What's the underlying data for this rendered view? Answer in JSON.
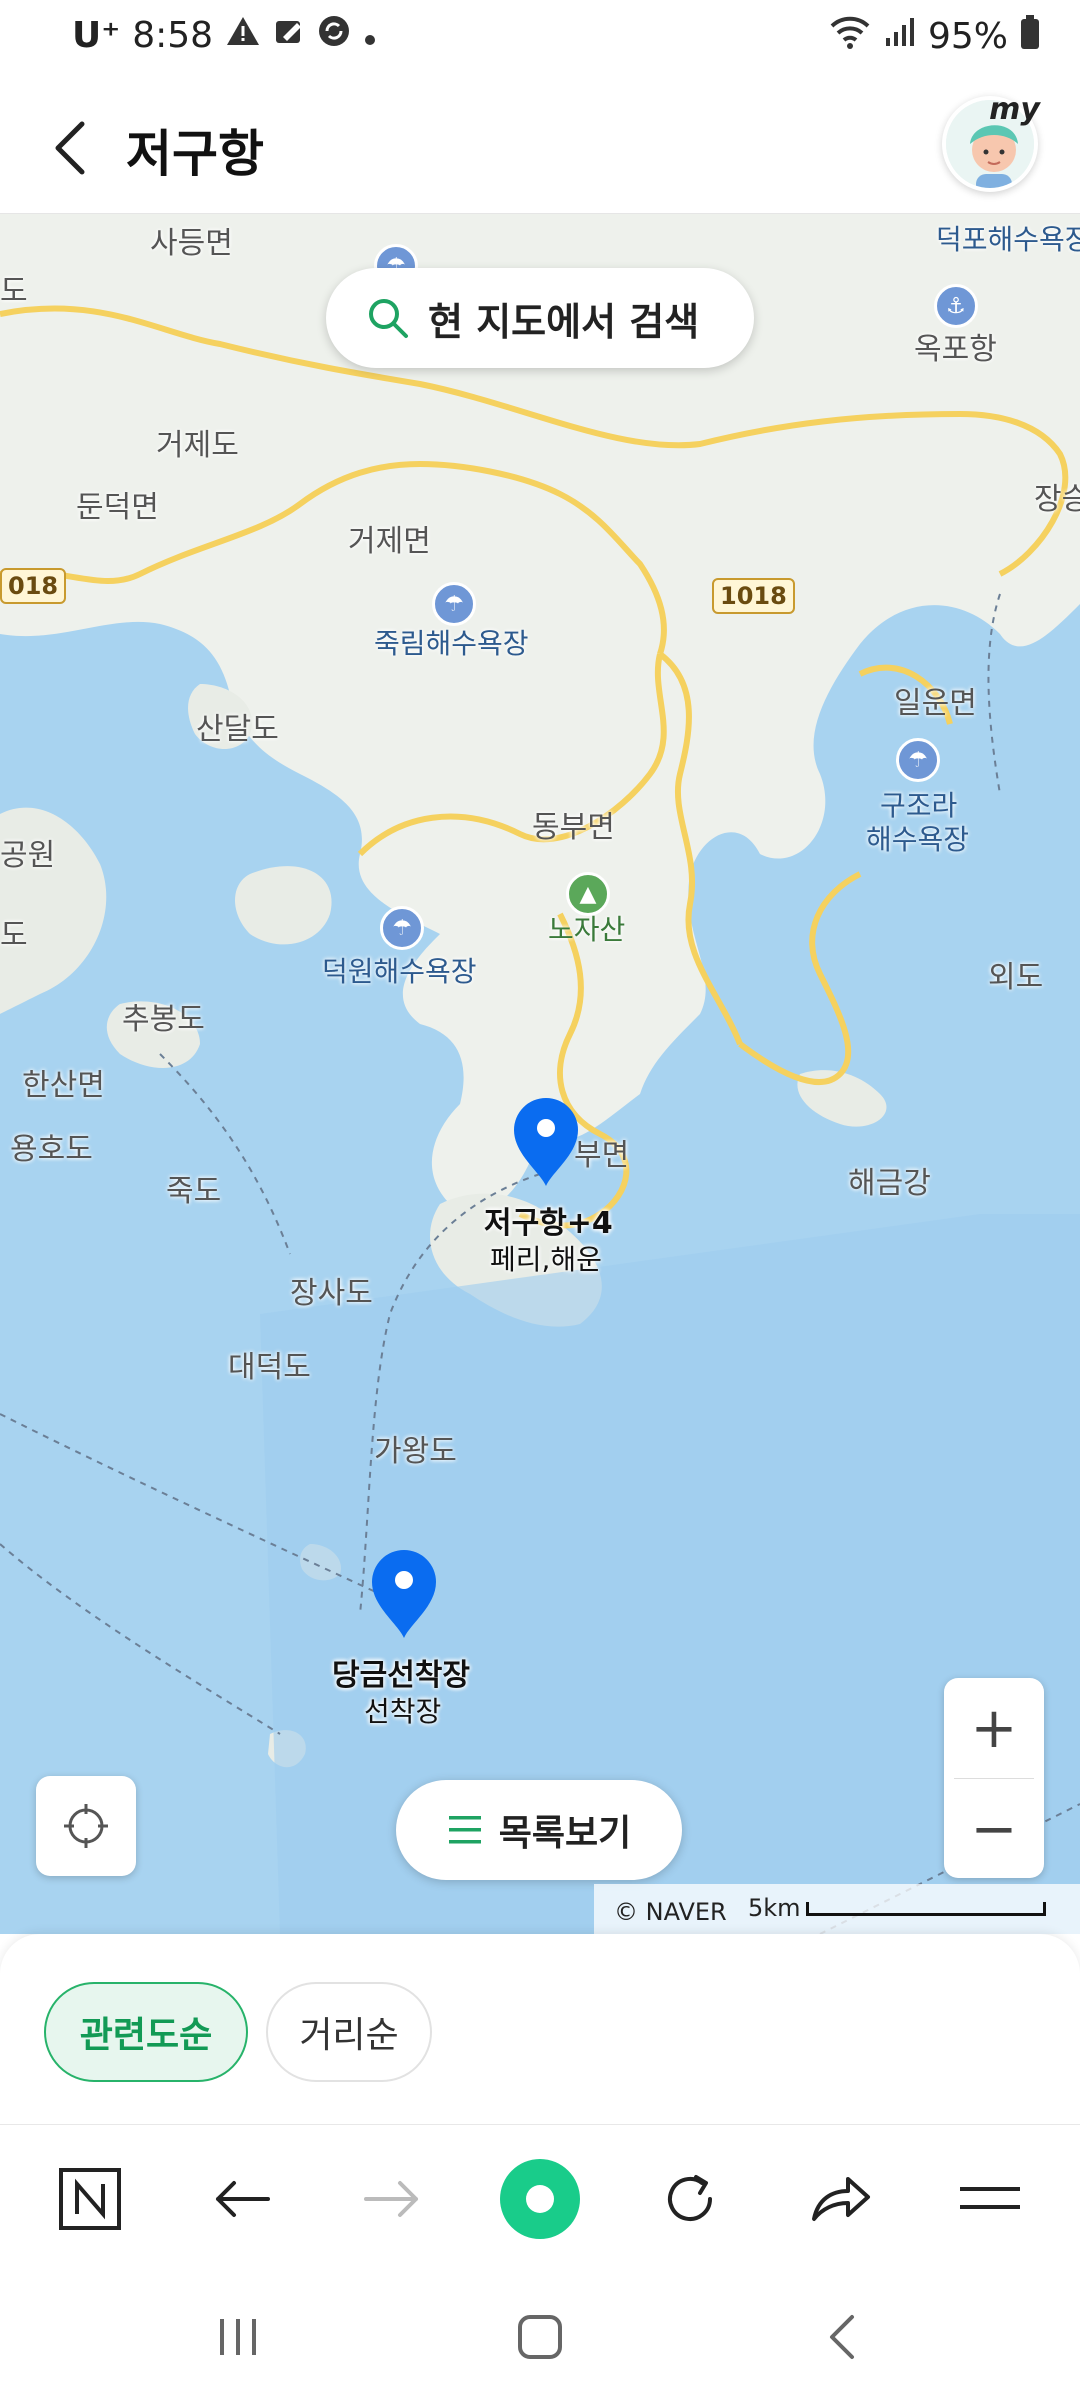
{
  "status_bar": {
    "carrier": "U⁺",
    "time": "8:58",
    "battery": "95%"
  },
  "header": {
    "title": "저구항",
    "avatar_badge": "my"
  },
  "map": {
    "search_label": "현 지도에서 검색",
    "labels": {
      "sadeung": "사등면",
      "deokpo": "덕포해수욕장",
      "okpo": "옥포항",
      "geojedo": "거제도",
      "dundeok": "둔덕면",
      "geoje_myeon": "거제면",
      "jukrim": "죽림해수욕장",
      "sandaldo": "산달도",
      "ilun": "일운면",
      "gujora": "구조라",
      "gujora2": "해수욕장",
      "dongbu": "동부면",
      "nojasan": "노자산",
      "deokwon": "덕원해수욕장",
      "oedo": "외도",
      "chubongdo": "추봉도",
      "hansan": "한산면",
      "yonghodo": "용호도",
      "jukdo": "죽도",
      "nambu": "부면",
      "haegeumgang": "해금강",
      "sajado": "장사도",
      "daedeokdo": "대덕도",
      "gawangdo": "가왕도",
      "edge_left1": "도",
      "edge_left2": "공원",
      "edge_left3": "도",
      "edge_right": "장승",
      "road_left": "018"
    },
    "road_badge": "1018",
    "markers": [
      {
        "title": "저구항+4",
        "subtitle": "페리,해운"
      },
      {
        "title": "당금선착장",
        "subtitle": "선착장"
      }
    ],
    "list_button": "목록보기",
    "zoom_in": "+",
    "zoom_out": "−",
    "copyright": "© NAVER",
    "scale": "5km"
  },
  "sort_chips": {
    "active": "관련도순",
    "inactive": "거리순"
  },
  "colors": {
    "accent_green": "#27b36a",
    "marker_blue": "#0a6cf0",
    "water": "#a8d3f0",
    "land": "#eef1ec"
  }
}
